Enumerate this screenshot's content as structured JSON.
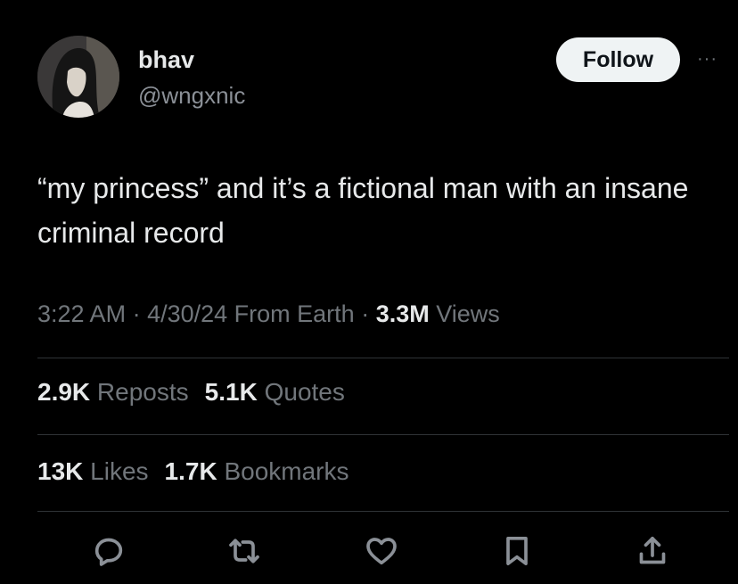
{
  "author": {
    "display_name": "bhav",
    "handle": "@wngxnic"
  },
  "follow_label": "Follow",
  "more_label": "···",
  "tweet": {
    "text": "“my princess” and it’s a fictional man with an insane criminal record"
  },
  "meta": {
    "time": "3:22 AM",
    "sep1": " · ",
    "date": "4/30/24",
    "source": " From Earth",
    "sep2": " · ",
    "views_count": "3.3M",
    "views_label": " Views"
  },
  "stats": {
    "reposts_count": "2.9K",
    "reposts_label": " Reposts",
    "quotes_count": "5.1K",
    "quotes_label": " Quotes",
    "likes_count": "13K",
    "likes_label": " Likes",
    "bookmarks_count": "1.7K",
    "bookmarks_label": " Bookmarks"
  },
  "icons": {
    "reply": "reply-icon",
    "repost": "repost-icon",
    "like": "heart-icon",
    "bookmark": "bookmark-icon",
    "share": "share-icon"
  },
  "colors": {
    "background": "#000000",
    "text": "#e7e9ea",
    "muted": "#71767b",
    "follow_bg": "#eff3f4"
  }
}
